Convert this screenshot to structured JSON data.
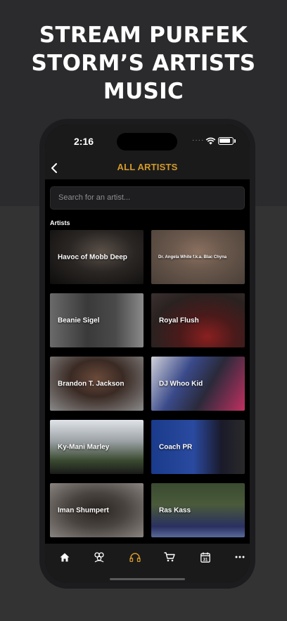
{
  "promo": {
    "title": "STREAM PURFEK\nSTORM’S ARTISTS\nMUSIC"
  },
  "status_bar": {
    "time": "2:16",
    "dots": "····"
  },
  "nav": {
    "title": "ALL ARTISTS"
  },
  "search": {
    "placeholder": "Search for an artist..."
  },
  "section": {
    "label": "Artists"
  },
  "artists": [
    {
      "name": "Havoc of Mobb Deep"
    },
    {
      "name": "Dr. Angela White f.k.a. Blac Chyna"
    },
    {
      "name": "Beanie Sigel"
    },
    {
      "name": "Royal Flush"
    },
    {
      "name": "Brandon T. Jackson"
    },
    {
      "name": "DJ Whoo Kid"
    },
    {
      "name": "Ky-Mani Marley"
    },
    {
      "name": "Coach PR"
    },
    {
      "name": "Iman Shumpert"
    },
    {
      "name": "Ras Kass"
    }
  ],
  "tabs": [
    {
      "icon": "home-icon",
      "active": false
    },
    {
      "icon": "community-icon",
      "active": false
    },
    {
      "icon": "headphones-icon",
      "active": true
    },
    {
      "icon": "cart-icon",
      "active": false
    },
    {
      "icon": "calendar-icon",
      "label": "31",
      "active": false
    },
    {
      "icon": "more-icon",
      "active": false
    }
  ],
  "colors": {
    "accent": "#d49a2a",
    "background": "#000000",
    "bar": "#1a1a1a"
  }
}
